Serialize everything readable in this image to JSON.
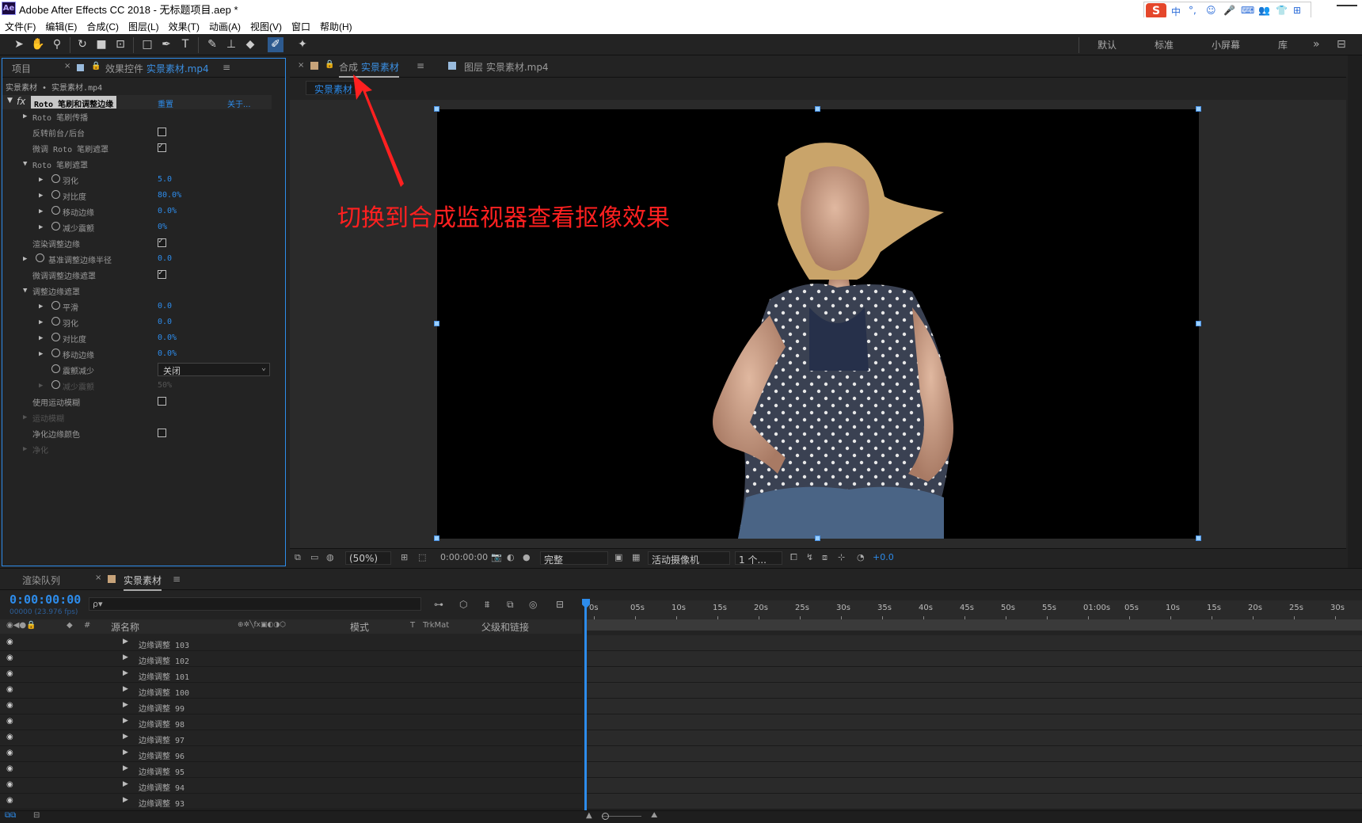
{
  "window": {
    "title": "Adobe After Effects CC 2018 - 无标题项目.aep *",
    "logo": "Ae"
  },
  "ime": {
    "logo": "S",
    "items": [
      "中",
      "°,",
      "☺",
      "🎤",
      "⌨",
      "👥",
      "👕",
      "⊞"
    ]
  },
  "menu": [
    "文件(F)",
    "编辑(E)",
    "合成(C)",
    "图层(L)",
    "效果(T)",
    "动画(A)",
    "视图(V)",
    "窗口",
    "帮助(H)"
  ],
  "workspaces": [
    "默认",
    "标准",
    "小屏幕",
    "库"
  ],
  "left_panel": {
    "tab_project": "项目",
    "tab_effects_prefix": "效果控件",
    "tab_effects_file": "实景素材.mp4",
    "breadcrumb": "实景素材 • 实景素材.mp4",
    "effect_name": "Roto 笔刷和调整边缘",
    "reset": "重置",
    "about": "关于...",
    "rows": [
      {
        "label": "Roto 笔刷传播",
        "type": "group"
      },
      {
        "label": "反转前台/后台",
        "type": "checkbox",
        "checked": false
      },
      {
        "label": "微调 Roto 笔刷遮罩",
        "type": "checkbox",
        "checked": true
      },
      {
        "label": "Roto 笔刷遮罩",
        "type": "group-open"
      },
      {
        "label": "羽化",
        "type": "value",
        "value": "5.0"
      },
      {
        "label": "对比度",
        "type": "value",
        "value": "80.0%"
      },
      {
        "label": "移动边缘",
        "type": "value",
        "value": "0.0%"
      },
      {
        "label": "减少震颤",
        "type": "value",
        "value": "0%"
      },
      {
        "label": "渲染调整边缘",
        "type": "checkbox",
        "checked": true
      },
      {
        "label": "基准调整边缘半径",
        "type": "value",
        "value": "0.0"
      },
      {
        "label": "微调调整边缘遮罩",
        "type": "checkbox",
        "checked": true
      },
      {
        "label": "调整边缘遮罩",
        "type": "group-open"
      },
      {
        "label": "平滑",
        "type": "value",
        "value": "0.0"
      },
      {
        "label": "羽化",
        "type": "value",
        "value": "0.0"
      },
      {
        "label": "对比度",
        "type": "value",
        "value": "0.0%"
      },
      {
        "label": "移动边缘",
        "type": "value",
        "value": "0.0%"
      },
      {
        "label": "震颤减少",
        "type": "dropdown",
        "value": "关闭"
      },
      {
        "label": "减少震颤",
        "type": "value-dim",
        "value": "50%"
      },
      {
        "label": "使用运动模糊",
        "type": "checkbox",
        "checked": false
      },
      {
        "label": "运动模糊",
        "type": "group-dim"
      },
      {
        "label": "净化边缘颜色",
        "type": "checkbox",
        "checked": false
      },
      {
        "label": "净化",
        "type": "group-dim"
      }
    ]
  },
  "comp_panel": {
    "tab_comp_prefix": "合成",
    "tab_comp_name": "实景素材",
    "tab_layer": "图层 实景素材.mp4",
    "sub_tab": "实景素材",
    "zoom": "(50%)",
    "timecode": "0:00:00:00",
    "quality": "完整",
    "camera": "活动摄像机",
    "views": "1 个...",
    "exposure": "+0.0"
  },
  "annotation": "切换到合成监视器查看抠像效果",
  "timeline": {
    "tab_render": "渲染队列",
    "tab_comp": "实景素材",
    "timecode": "0:00:00:00",
    "fps": "00000 (23.976 fps)",
    "search_placeholder": "ρ▾",
    "col_source": "源名称",
    "col_mode": "模式",
    "col_t": "T",
    "col_trkmat": "TrkMat",
    "col_parent": "父级和链接",
    "col_num": "#",
    "ruler": [
      "0s",
      "05s",
      "10s",
      "15s",
      "20s",
      "25s",
      "30s",
      "35s",
      "40s",
      "45s",
      "50s",
      "55s",
      "01:00s",
      "05s",
      "10s",
      "15s",
      "20s",
      "25s",
      "30s"
    ],
    "layers": [
      "边缘调整 103",
      "边缘调整 102",
      "边缘调整 101",
      "边缘调整 100",
      "边缘调整 99",
      "边缘调整 98",
      "边缘调整 97",
      "边缘调整 96",
      "边缘调整 95",
      "边缘调整 94",
      "边缘调整 93"
    ]
  },
  "colors": {
    "accent": "#2d8ceb",
    "annotation": "#ff2020",
    "comp_swatch": "#c7a37a"
  }
}
